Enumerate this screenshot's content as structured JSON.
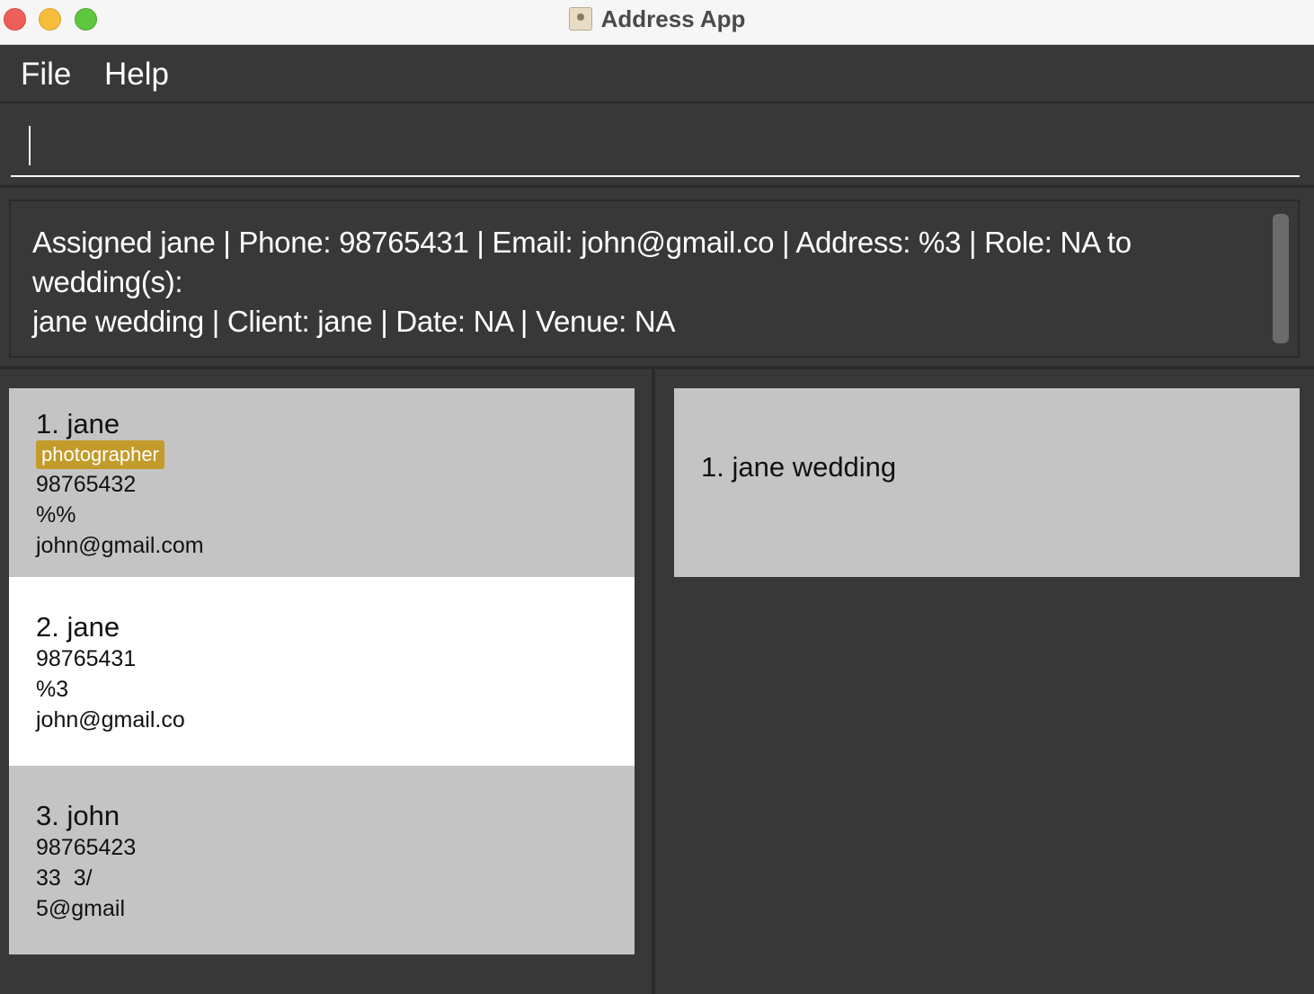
{
  "window": {
    "title": "Address App"
  },
  "menu": {
    "file": "File",
    "help": "Help"
  },
  "command": {
    "value": "",
    "placeholder": ""
  },
  "result": {
    "text": "Assigned jane | Phone: 98765431 | Email: john@gmail.co | Address: %3 | Role: NA to\nwedding(s):\njane wedding | Client: jane | Date: NA | Venue: NA"
  },
  "persons": [
    {
      "name": "1. jane",
      "tag": "photographer",
      "phone": "98765432",
      "address": "%%",
      "email": "john@gmail.com"
    },
    {
      "name": "2. jane",
      "phone": "98765431",
      "address": "%3",
      "email": "john@gmail.co"
    },
    {
      "name": "3. john",
      "phone": "98765423",
      "address": "33  3/",
      "email": "5@gmail"
    }
  ],
  "weddings": [
    {
      "name": "1. jane wedding"
    }
  ],
  "colors": {
    "background": "#383838",
    "card": "#c4c4c4",
    "selected_card": "#ffffff",
    "tag": "#c39b2a"
  }
}
